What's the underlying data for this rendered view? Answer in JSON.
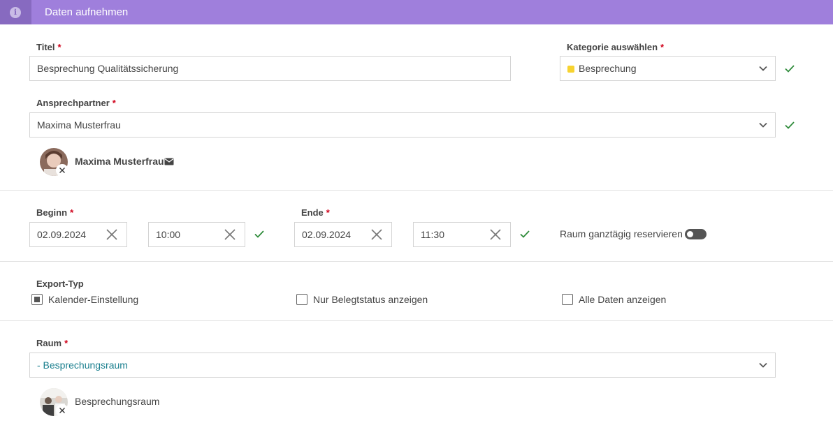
{
  "header": {
    "title": "Daten aufnehmen",
    "icon": "info-icon"
  },
  "required_mark": "*",
  "titel": {
    "label": "Titel",
    "value": "Besprechung Qualitätssicherung"
  },
  "kategorie": {
    "label": "Kategorie auswählen",
    "value": "Besprechung",
    "color": "#f7d330"
  },
  "ansprechpartner": {
    "label": "Ansprechpartner",
    "value": "Maxima Musterfrau",
    "selected": {
      "name": "Maxima Musterfrau",
      "icon": "mail-icon"
    }
  },
  "beginn": {
    "label": "Beginn",
    "date": "02.09.2024",
    "time": "10:00"
  },
  "ende": {
    "label": "Ende",
    "date": "02.09.2024",
    "time": "11:30"
  },
  "raum_ganztaegig": {
    "label": "Raum ganztägig reservieren",
    "on": false
  },
  "export_typ": {
    "label": "Export-Typ",
    "options": [
      {
        "label": "Kalender-Einstellung",
        "checked": true
      },
      {
        "label": "Nur Belegtstatus anzeigen",
        "checked": false
      },
      {
        "label": "Alle Daten anzeigen",
        "checked": false
      }
    ]
  },
  "raum": {
    "label": "Raum",
    "value": "- Besprechungsraum",
    "selected": {
      "name": "Besprechungsraum"
    }
  },
  "colors": {
    "accent": "#9f7fdc",
    "accent_dark": "#876ac0",
    "valid": "#2e8b3a",
    "link": "#1a7f8e",
    "required": "#d0021b"
  }
}
